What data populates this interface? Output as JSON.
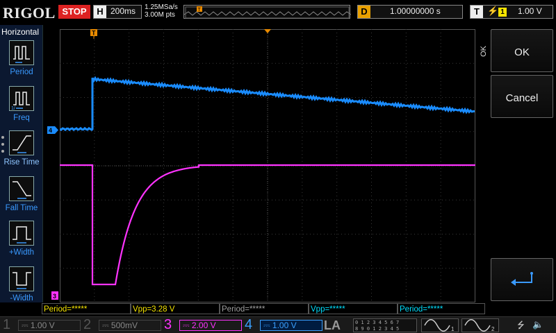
{
  "header": {
    "brand": "RIGOL",
    "run_state": "STOP",
    "timebase_letter": "H",
    "timebase": "200ms",
    "sample_rate": "1.25MSa/s",
    "memory_depth": "3.00M pts",
    "delay_letter": "D",
    "delay": "1.00000000 s",
    "trigger_letter": "T",
    "trigger_channel": "1",
    "trigger_level": "1.00 V"
  },
  "menu": {
    "title": "Horizontal",
    "items": [
      {
        "label": "Period",
        "icon": "period-icon"
      },
      {
        "label": "Freq",
        "icon": "frequency-icon"
      },
      {
        "label": "Rise Time",
        "icon": "rise-time-icon"
      },
      {
        "label": "Fall Time",
        "icon": "fall-time-icon"
      },
      {
        "label": "+Width",
        "icon": "positive-width-icon"
      },
      {
        "label": "-Width",
        "icon": "negative-width-icon"
      }
    ]
  },
  "right_panel": {
    "side_label": "OK",
    "ok_label": "OK",
    "cancel_label": "Cancel"
  },
  "markers": {
    "trigger_position": "T",
    "ch4_marker": "4",
    "ch3_marker": "3",
    "trigger_level_marker": "T"
  },
  "measurements": [
    {
      "text": "Period=*****",
      "style": "ch3"
    },
    {
      "text": "Vpp=3.28 V",
      "style": "ch3"
    },
    {
      "text": "Period=*****",
      "style": "dim"
    },
    {
      "text": "Vpp=*****",
      "style": "ch2"
    },
    {
      "text": "Period=*****",
      "style": "ch2"
    }
  ],
  "channels": [
    {
      "num": "1",
      "scale": "1.00 V",
      "state": "off"
    },
    {
      "num": "2",
      "scale": "500mV",
      "state": "off"
    },
    {
      "num": "3",
      "scale": "2.00 V",
      "state": "on"
    },
    {
      "num": "4",
      "scale": "1.00 V",
      "state": "on"
    }
  ],
  "la": {
    "label": "LA",
    "row1": "0 1 2 3  4 5 6 7",
    "row2": "8 9 0 1  2 3 4 5"
  },
  "colors": {
    "ch3": "#ff33ff",
    "ch4": "#1a8cff",
    "trigger": "#e88a00",
    "grid": "#3a3a3a"
  }
}
